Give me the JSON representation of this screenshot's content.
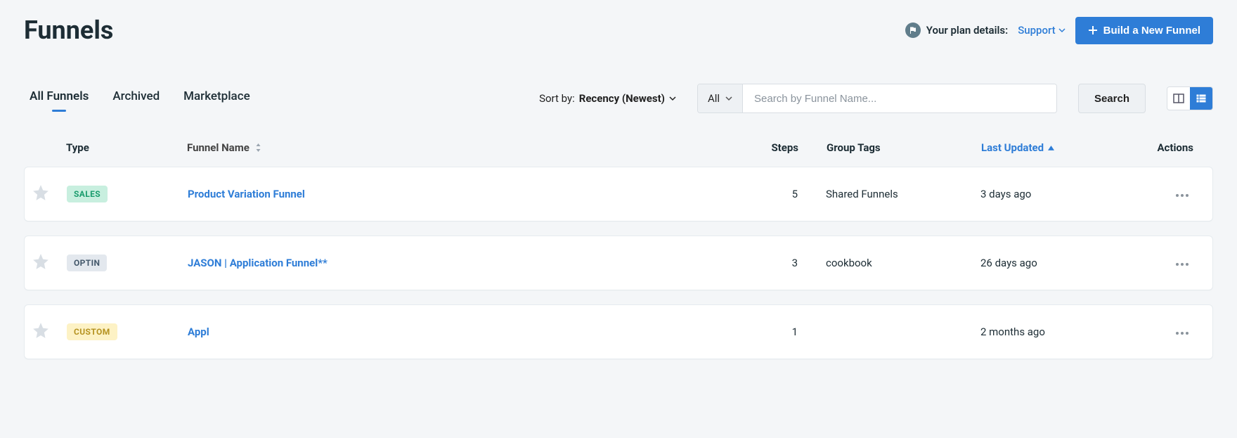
{
  "header": {
    "title": "Funnels",
    "plan_label": "Your plan details:",
    "support_label": "Support",
    "build_btn": "Build a New Funnel"
  },
  "tabs": {
    "items": [
      {
        "label": "All Funnels",
        "active": true
      },
      {
        "label": "Archived",
        "active": false
      },
      {
        "label": "Marketplace",
        "active": false
      }
    ]
  },
  "sort": {
    "prefix": "Sort by: ",
    "value": "Recency (Newest)"
  },
  "filter": {
    "selected": "All"
  },
  "search": {
    "placeholder": "Search by Funnel Name...",
    "button": "Search"
  },
  "columns": {
    "type": "Type",
    "name": "Funnel Name",
    "steps": "Steps",
    "tags": "Group Tags",
    "updated": "Last Updated",
    "actions": "Actions"
  },
  "rows": [
    {
      "type_label": "SALES",
      "type_class": "badge-sales",
      "name": "Product Variation Funnel",
      "steps": "5",
      "tags": "Shared Funnels",
      "updated": "3 days ago"
    },
    {
      "type_label": "OPTIN",
      "type_class": "badge-optin",
      "name": "JASON | Application Funnel**",
      "steps": "3",
      "tags": "cookbook",
      "updated": "26 days ago"
    },
    {
      "type_label": "CUSTOM",
      "type_class": "badge-custom",
      "name": "Appl",
      "steps": "1",
      "tags": "",
      "updated": "2 months ago"
    }
  ]
}
